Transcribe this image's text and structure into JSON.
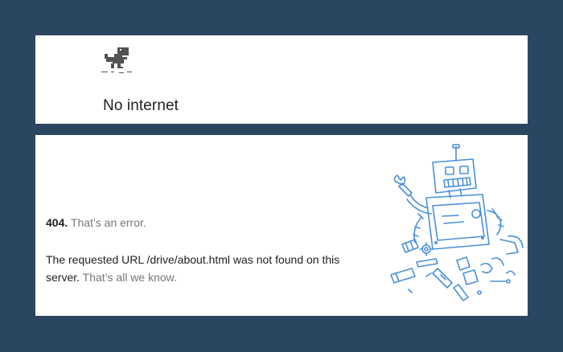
{
  "offline_panel": {
    "heading": "No internet",
    "icon": "dino-icon"
  },
  "error_panel": {
    "code": "404.",
    "code_suffix": "That’s an error.",
    "message_main": "The requested URL /drive/about.html was not found on this server.",
    "message_suffix": "That’s all we know.",
    "illustration": "broken-robot-illustration"
  },
  "colors": {
    "background": "#2b4661",
    "panel": "#ffffff",
    "robot_stroke": "#4a90d9",
    "muted_text": "#777777"
  }
}
